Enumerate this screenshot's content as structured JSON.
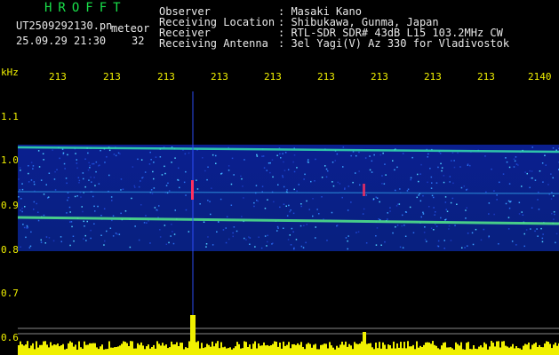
{
  "header": {
    "app_title": "HROFFT",
    "file_name": "UT2509292130.pn",
    "meteor_label": "meteor",
    "datetime": "25.09.29 21:30",
    "count": "32",
    "info": [
      {
        "key": "Observer",
        "value": ": Masaki Kano"
      },
      {
        "key": "Receiving Location",
        "value": ": Shibukawa, Gunma, Japan"
      },
      {
        "key": "Receiver",
        "value": ": RTL-SDR SDR# 43dB L15 103.2MHz CW"
      },
      {
        "key": "Receiving Antenna",
        "value": ": 3el Yagi(V) Az 330 for Vladivostok"
      }
    ]
  },
  "axes": {
    "y_unit": "kHz",
    "x_ticks": [
      "213",
      "213",
      "213",
      "213",
      "213",
      "213",
      "213",
      "213",
      "213",
      "2140"
    ],
    "y_ticks": [
      "1.1",
      "1.0",
      "0.9",
      "0.8",
      "0.7",
      "0.6"
    ]
  },
  "colors": {
    "title_green": "#19e04a",
    "tick_yellow": "#f0f000",
    "text_white": "#e8e8e8",
    "spectrum_bg": "#0a1f8f",
    "echo_red": "#ff3060"
  }
}
